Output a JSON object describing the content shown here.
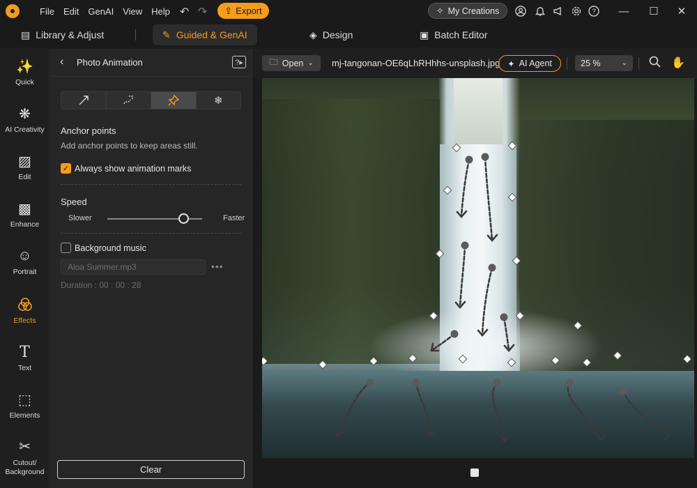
{
  "app": {
    "menu": [
      "File",
      "Edit",
      "GenAI",
      "View",
      "Help"
    ],
    "export_label": "Export",
    "my_creations_label": "My Creations"
  },
  "tabs": [
    {
      "label": "Library & Adjust",
      "icon": "library-icon"
    },
    {
      "label": "Guided & GenAI",
      "icon": "magic-wand-icon",
      "active": true
    },
    {
      "label": "Design",
      "icon": "layers-icon"
    },
    {
      "label": "Batch Editor",
      "icon": "images-icon"
    }
  ],
  "leftnav": [
    {
      "label": "Quick",
      "icon": "magic-icon"
    },
    {
      "label": "AI Creativity",
      "icon": "ai-creativity-icon"
    },
    {
      "label": "Edit",
      "icon": "edit-icon"
    },
    {
      "label": "Enhance",
      "icon": "enhance-icon"
    },
    {
      "label": "Portrait",
      "icon": "portrait-icon"
    },
    {
      "label": "Effects",
      "icon": "effects-icon",
      "active": true
    },
    {
      "label": "Text",
      "icon": "text-icon"
    },
    {
      "label": "Elements",
      "icon": "elements-icon"
    },
    {
      "label": "Cutout/\nBackground",
      "icon": "cutout-icon"
    }
  ],
  "panel": {
    "title": "Photo Animation",
    "tools": [
      "arrow-tool-icon",
      "curve-arrow-tool-icon",
      "anchor-pin-tool-icon",
      "freeze-tool-icon"
    ],
    "active_tool": 2,
    "anchor_title": "Anchor points",
    "anchor_desc": "Add anchor points to keep areas still.",
    "always_show_label": "Always show animation marks",
    "always_show_checked": true,
    "speed_title": "Speed",
    "speed_min_label": "Slower",
    "speed_max_label": "Faster",
    "speed_value": 0.8,
    "music_label": "Background music",
    "music_checked": false,
    "music_file": "Aloa Summer.mp3",
    "duration": "Duration : 00 : 00 : 28",
    "clear_label": "Clear"
  },
  "canvas_toolbar": {
    "open_label": "Open",
    "filename": "mj-tangonan-OE6qLhRHhhs-unsplash.jpg",
    "ai_agent_label": "AI Agent",
    "zoom": "25 %"
  },
  "colors": {
    "accent": "#f59c1a",
    "background": "#1c1c1c",
    "panel": "#262626"
  }
}
